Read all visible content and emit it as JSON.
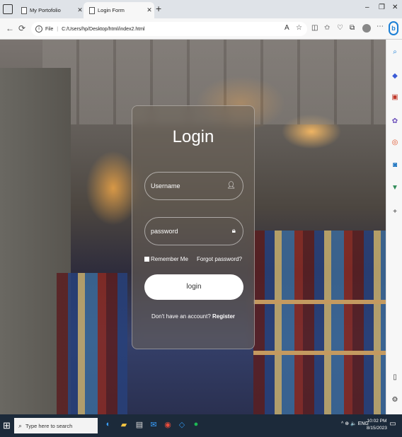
{
  "browser": {
    "tabs": [
      {
        "label": "My Portofolio",
        "active": false
      },
      {
        "label": "Login Form",
        "active": true
      }
    ],
    "new_tab": "+",
    "window_controls": {
      "minimize": "–",
      "maximize": "❐",
      "close": "✕"
    },
    "address": {
      "scheme": "File",
      "url": "C:/Users/hp/Desktop/html/index2.html"
    },
    "nav": {
      "back": "←",
      "reload": "⟳"
    },
    "toolbar_icons": [
      "read-aloud-icon",
      "favorite-star-icon",
      "split-screen-icon",
      "favorites-icon",
      "browser-essentials-icon",
      "collections-icon",
      "profile-icon",
      "more-icon",
      "copilot-icon"
    ]
  },
  "login": {
    "title": "Login",
    "username_placeholder": "Username",
    "password_placeholder": "password",
    "remember_label": "Remember Me",
    "forgot_label": "Forgot password?",
    "button_label": "login",
    "no_account_text": "Don't have an account?",
    "register_label": "Register"
  },
  "sidebar_icons": [
    "search-icon",
    "shopping-icon",
    "tools-icon",
    "games-icon",
    "office-icon",
    "outlook-icon",
    "bing-icon",
    "add-icon",
    "sidebar-toggle-icon",
    "settings-icon"
  ],
  "taskbar": {
    "search_placeholder": "Type here to search",
    "tray_text": "^ ⊕ 🔈 ENG",
    "time": "10:02 PM",
    "date": "8/15/2023"
  }
}
